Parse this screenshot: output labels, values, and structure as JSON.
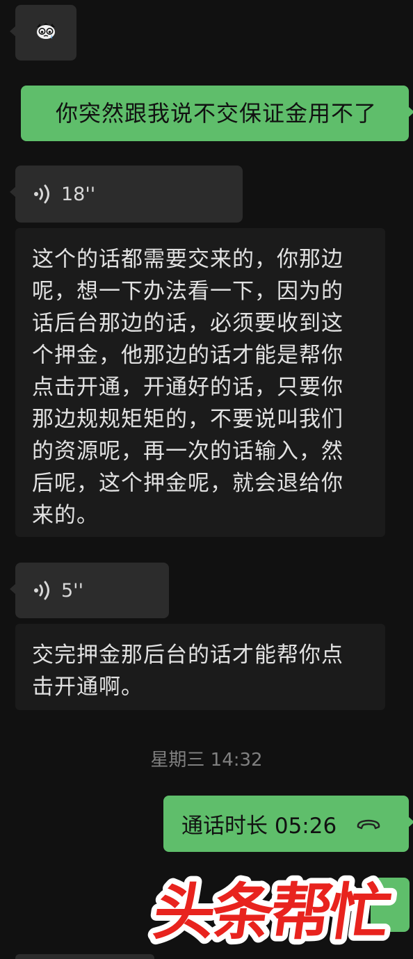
{
  "messages": {
    "outgoing_text": "你突然跟我说不交保证金用不了",
    "voice_1": {
      "duration": "18''"
    },
    "transcript_1": [
      "这个的话都需要交来的，你那边",
      "呢，想一下办法看一下，因为的",
      "话后台那边的话，必须要收到这",
      "个押金，他那边的话才能是帮你",
      "点击开通，开通好的话，只要你",
      "那边规规矩矩的，不要说叫我们",
      "的资源呢，再一次的话输入，然",
      "后呢，这个押金呢，就会退给你",
      "来的。"
    ],
    "voice_2": {
      "duration": "5''"
    },
    "transcript_2": [
      "交完押金那后台的话才能帮你点",
      "击开通啊。"
    ],
    "timestamp": "星期三 14:32",
    "call": {
      "label": "通话时长 05:26"
    }
  },
  "watermark": {
    "text": "头条帮忙"
  },
  "colors": {
    "background": "#111111",
    "incoming_bubble": "#2c2c2c",
    "outgoing_bubble": "#5fbe6b",
    "watermark_red": "#e8231e"
  },
  "icons": {
    "sticker": "crying-face-sticker-icon",
    "voice": "voice-wave-icon",
    "call": "phone-hangup-icon"
  }
}
